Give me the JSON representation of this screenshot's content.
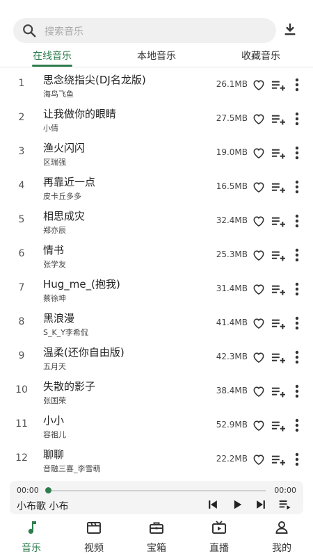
{
  "colors": {
    "accent": "#2e7d4f",
    "text": "#222222",
    "muted": "#a8a8a8",
    "search_bg": "#f0f0f0",
    "player_bg": "#f4f4f4"
  },
  "search": {
    "placeholder": "搜索音乐",
    "icon": "search-icon"
  },
  "header": {
    "download_icon": "download-icon"
  },
  "tabs": [
    {
      "label": "在线音乐",
      "active": true
    },
    {
      "label": "本地音乐",
      "active": false
    },
    {
      "label": "收藏音乐",
      "active": false
    }
  ],
  "songs": [
    {
      "index": "1",
      "title": "思念绕指尖(DJ名龙版)",
      "artist": "海鸟飞鱼",
      "size": "26.1MB"
    },
    {
      "index": "2",
      "title": "让我做你的眼睛",
      "artist": "小倩",
      "size": "27.5MB"
    },
    {
      "index": "3",
      "title": "渔火闪闪",
      "artist": "区瑞强",
      "size": "19.0MB"
    },
    {
      "index": "4",
      "title": "再靠近一点",
      "artist": "皮卡丘多多",
      "size": "16.5MB"
    },
    {
      "index": "5",
      "title": "相思成灾",
      "artist": "郑亦辰",
      "size": "32.4MB"
    },
    {
      "index": "6",
      "title": "情书",
      "artist": "张学友",
      "size": "25.3MB"
    },
    {
      "index": "7",
      "title": "Hug_me_(抱我)",
      "artist": "蔡徐坤",
      "size": "31.4MB"
    },
    {
      "index": "8",
      "title": "黑浪漫",
      "artist": "S_K_Y李希侃",
      "size": "41.4MB"
    },
    {
      "index": "9",
      "title": "温柔(还你自由版)",
      "artist": "五月天",
      "size": "42.3MB"
    },
    {
      "index": "10",
      "title": "失散的影子",
      "artist": "张国荣",
      "size": "38.4MB"
    },
    {
      "index": "11",
      "title": "小小",
      "artist": "容祖儿",
      "size": "52.9MB"
    },
    {
      "index": "12",
      "title": "聊聊",
      "artist": "音融三喜_李雪萌",
      "size": "22.2MB"
    }
  ],
  "player": {
    "current_time": "00:00",
    "total_time": "00:00",
    "progress": 0,
    "now_playing": "小布歌 小布"
  },
  "nav": [
    {
      "label": "音乐",
      "icon": "music-note-icon",
      "active": true
    },
    {
      "label": "视频",
      "icon": "film-clapper-icon",
      "active": false
    },
    {
      "label": "宝箱",
      "icon": "treasure-box-icon",
      "active": false
    },
    {
      "label": "直播",
      "icon": "tv-icon",
      "active": false
    },
    {
      "label": "我的",
      "icon": "person-icon",
      "active": false
    }
  ]
}
